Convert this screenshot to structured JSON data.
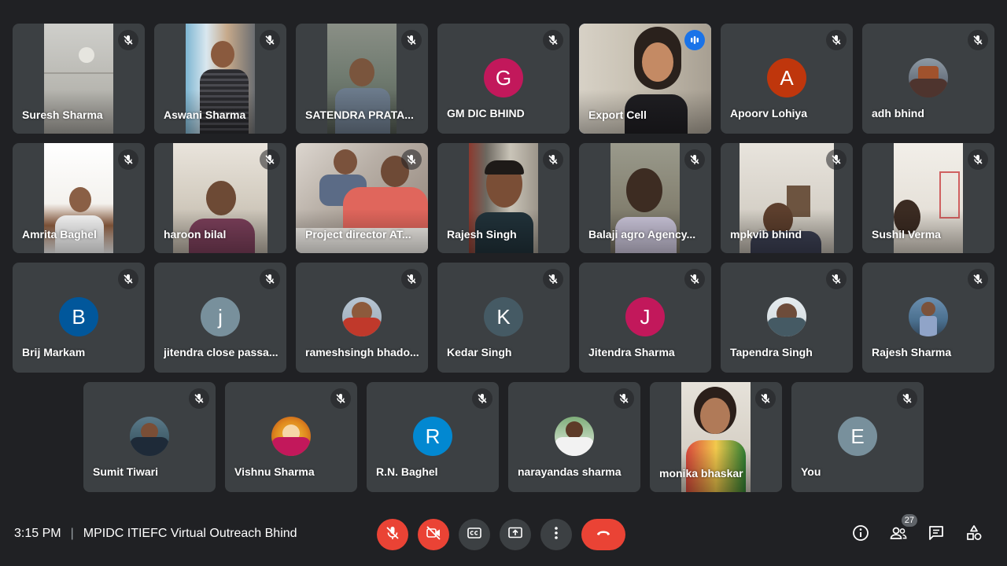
{
  "participants": [
    {
      "name": "Suresh Sharma",
      "type": "video"
    },
    {
      "name": "Aswani Sharma",
      "type": "video"
    },
    {
      "name": "SATENDRA PRATA...",
      "type": "video"
    },
    {
      "name": "GM DIC BHIND",
      "type": "avatar",
      "initial": "G",
      "color": "#c2185b"
    },
    {
      "name": "Export Cell",
      "type": "video",
      "speaking": true
    },
    {
      "name": "Apoorv Lohiya",
      "type": "avatar",
      "initial": "A",
      "color": "#bf360c"
    },
    {
      "name": "adh bhind",
      "type": "photo"
    },
    {
      "name": "Amrita Baghel",
      "type": "video"
    },
    {
      "name": "haroon bilal",
      "type": "video"
    },
    {
      "name": "Project director AT...",
      "type": "video"
    },
    {
      "name": "Rajesh Singh",
      "type": "video"
    },
    {
      "name": "Balaji agro Agency...",
      "type": "video"
    },
    {
      "name": "mpkvib bhind",
      "type": "video"
    },
    {
      "name": "Sushil Verma",
      "type": "video"
    },
    {
      "name": "Brij Markam",
      "type": "avatar",
      "initial": "B",
      "color": "#01579b"
    },
    {
      "name": "jitendra close passa...",
      "type": "avatar",
      "initial": "j",
      "color": "#78909c"
    },
    {
      "name": "rameshsingh bhado...",
      "type": "photo"
    },
    {
      "name": "Kedar Singh",
      "type": "avatar",
      "initial": "K",
      "color": "#455a64"
    },
    {
      "name": "Jitendra Sharma",
      "type": "avatar",
      "initial": "J",
      "color": "#c2185b"
    },
    {
      "name": "Tapendra Singh",
      "type": "photo"
    },
    {
      "name": "Rajesh Sharma",
      "type": "photo"
    },
    {
      "name": "Sumit Tiwari",
      "type": "photo"
    },
    {
      "name": "Vishnu Sharma",
      "type": "photo"
    },
    {
      "name": "R.N. Baghel",
      "type": "avatar",
      "initial": "R",
      "color": "#0288d1"
    },
    {
      "name": "narayandas sharma",
      "type": "photo"
    },
    {
      "name": "monika bhaskar",
      "type": "video"
    },
    {
      "name": "You",
      "type": "avatar",
      "initial": "E",
      "color": "#78909c"
    }
  ],
  "bottom_bar": {
    "time": "3:15 PM",
    "separator": "|",
    "meeting_title": "MPIDC ITIEFC Virtual Outreach Bhind",
    "participant_count": "27",
    "controls": {
      "mic": "mic-off-icon",
      "camera": "camera-off-icon",
      "captions": "captions-icon",
      "present": "present-screen-icon",
      "more": "more-options-icon",
      "leave": "leave-call-icon"
    },
    "right_icons": [
      "info-icon",
      "people-icon",
      "chat-icon",
      "activities-icon"
    ]
  },
  "colors": {
    "background": "#202124",
    "tile": "#3c4043",
    "danger": "#ea4335",
    "speaking": "#1a73e8",
    "active_outline": "#8ab4f8"
  }
}
